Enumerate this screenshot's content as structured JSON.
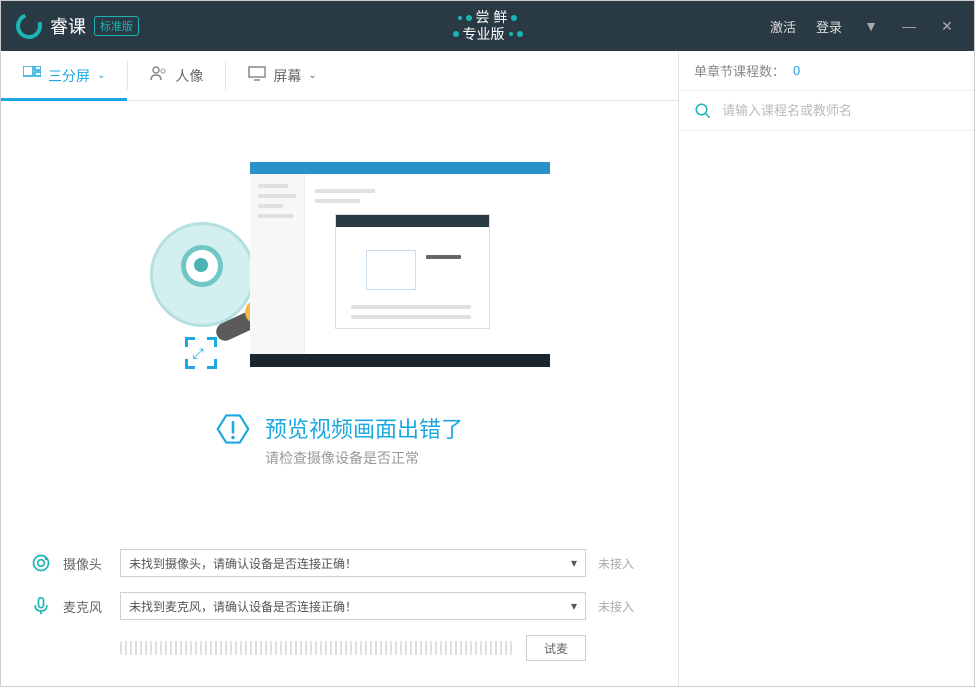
{
  "titlebar": {
    "app_name": "睿课",
    "edition": "标准版",
    "promo_line1": "尝 鲜",
    "promo_line2": "专业版",
    "activate": "激活",
    "login": "登录"
  },
  "tabs": {
    "triple": "三分屏",
    "portrait": "人像",
    "screen": "屏幕"
  },
  "preview_error": {
    "title": "预览视频画面出错了",
    "subtitle": "请检查摄像设备是否正常"
  },
  "devices": {
    "camera_label": "摄像头",
    "camera_value": "未找到摄像头，请确认设备是否连接正确！",
    "camera_status": "未接入",
    "mic_label": "麦克风",
    "mic_value": "未找到麦克风，请确认设备是否连接正确！",
    "mic_status": "未接入",
    "test_btn": "试麦"
  },
  "sidebar": {
    "chapter_count_label": "单章节课程数：",
    "chapter_count": "0",
    "search_placeholder": "请输入课程名或教师名"
  }
}
